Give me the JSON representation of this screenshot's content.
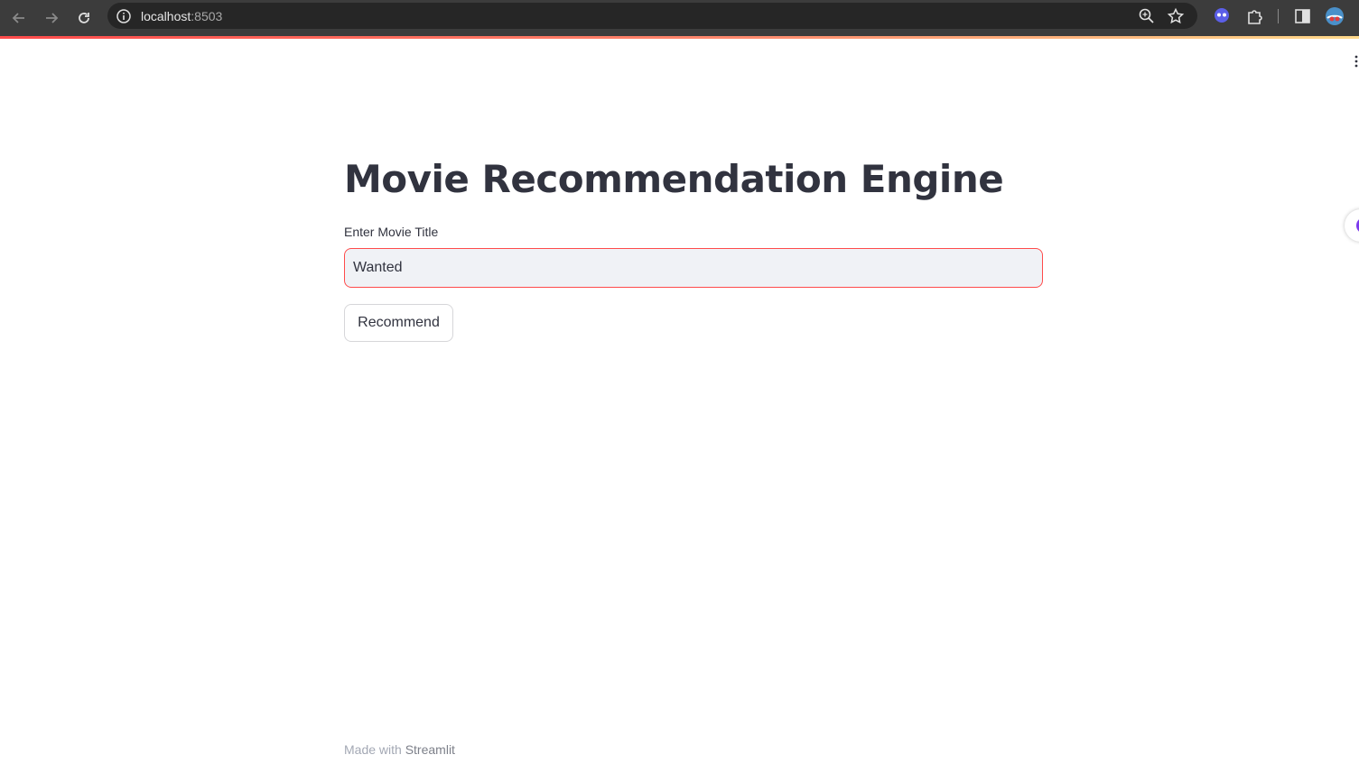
{
  "browser": {
    "url_host": "localhost",
    "url_port": ":8503",
    "icons": [
      "back-icon",
      "forward-icon",
      "reload-icon",
      "site-info-icon",
      "zoom-icon",
      "star-icon",
      "extension-ghost-icon",
      "extensions-puzzle-icon",
      "side-panel-icon",
      "profile-avatar"
    ]
  },
  "app": {
    "title": "Movie Recommendation Engine",
    "input_label": "Enter Movie Title",
    "input_value": "Wanted",
    "button_label": "Recommend",
    "footer_prefix": "Made with",
    "footer_link": "Streamlit"
  },
  "colors": {
    "primary": "#ff4b4b",
    "text": "#31333f",
    "input_bg": "#f0f2f6"
  }
}
